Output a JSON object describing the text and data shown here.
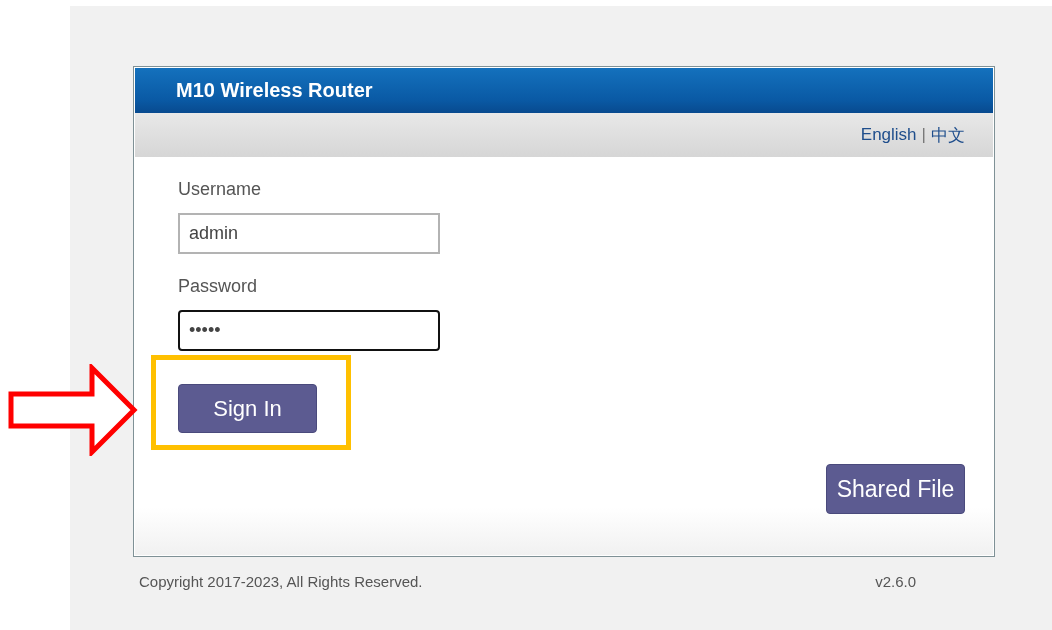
{
  "window": {
    "title": "M10 Wireless Router"
  },
  "language_links": [
    {
      "label": "English"
    },
    {
      "label": "中文"
    }
  ],
  "separator": "|",
  "username": {
    "label": "Username",
    "value": "admin",
    "focused": false
  },
  "password": {
    "label": "Password",
    "value": "•••••",
    "focused": true
  },
  "sign_in_button": {
    "label": "Sign In",
    "highlighted": true
  },
  "shared_file_button": {
    "label": "Shared File"
  },
  "footer": {
    "copyright": "Copyright 2017-2023, All Rights Reserved.",
    "version": "v2.6.0"
  }
}
